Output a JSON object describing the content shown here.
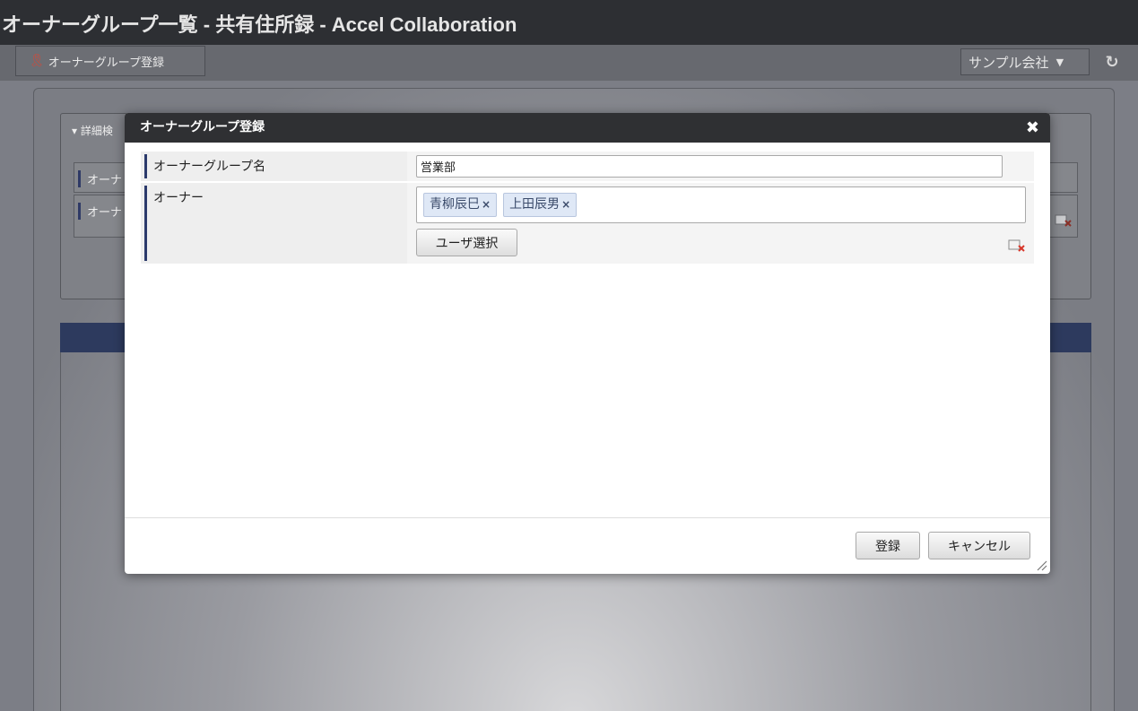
{
  "window": {
    "title": "オーナーグループ一覧 - 共有住所録 - Accel Collaboration"
  },
  "toolbar": {
    "tab_label": "オーナーグループ登録",
    "tab_icon": "ribbon-icon",
    "company_select": "サンプル会社",
    "reload_icon": "reload-icon"
  },
  "search_panel": {
    "title": "詳細検",
    "row1_label": "オーナ",
    "row2_label": "オーナ"
  },
  "dialog": {
    "title": "オーナーグループ登録",
    "close_glyph": "✖",
    "fields": {
      "group_name_label": "オーナーグループ名",
      "group_name_value": "営業部",
      "owner_label": "オーナー",
      "owners": [
        {
          "name": "青柳辰巳"
        },
        {
          "name": "上田辰男"
        }
      ],
      "remove_glyph": "×",
      "user_select_button": "ユーザ選択"
    },
    "buttons": {
      "register": "登録",
      "cancel": "キャンセル"
    }
  },
  "colors": {
    "header_bg": "#2f3033",
    "label_bar": "#2b3a6b",
    "tag_bg": "#dfe8f6",
    "clear_icon_red": "#d8372a"
  }
}
